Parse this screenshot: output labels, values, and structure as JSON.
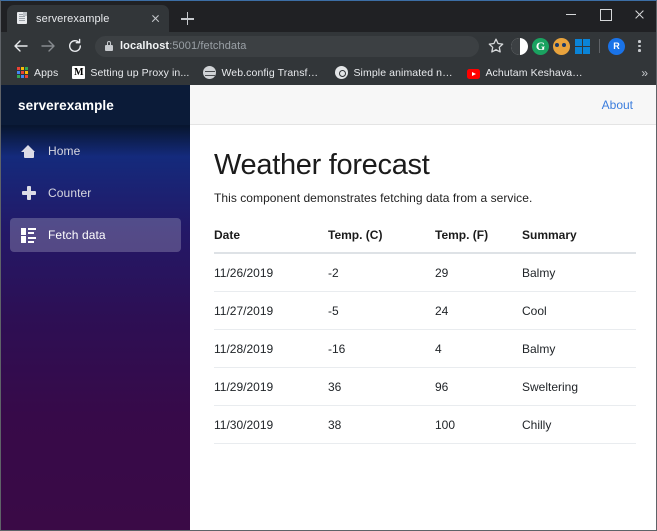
{
  "browser": {
    "tab": {
      "title": "serverexample",
      "favicon": "document-icon",
      "close_label": "",
      "new_tab_label": ""
    },
    "window_controls": {
      "minimize": "minimize-icon",
      "maximize": "maximize-icon",
      "close": "close-icon"
    },
    "toolbar": {
      "back": "back-arrow-icon",
      "forward": "forward-arrow-icon",
      "reload": "reload-icon",
      "lock": "lock-icon",
      "url_host": "localhost",
      "url_path": ":5001/fetchdata",
      "url_full": "localhost:5001/fetchdata",
      "bookmark_star": "star-icon",
      "extensions": [
        {
          "name": "half-moon-icon",
          "label": ""
        },
        {
          "name": "grammarly-icon",
          "label": "G"
        },
        {
          "name": "avatar-face-icon",
          "label": ""
        },
        {
          "name": "windows-icon",
          "label": ""
        }
      ],
      "profile_initial": "R",
      "menu": "kebab-menu-icon"
    },
    "bookmarks": {
      "items": [
        {
          "icon": "apps-grid-icon",
          "label": "Apps"
        },
        {
          "icon": "medium-icon",
          "label": "Setting up Proxy in..."
        },
        {
          "icon": "globe-icon",
          "label": "Web.config Transfo..."
        },
        {
          "icon": "gear-icon",
          "label": "Simple animated na..."
        },
        {
          "icon": "youtube-icon",
          "label": "Achutam Keshavam..."
        }
      ],
      "overflow": "»"
    }
  },
  "app": {
    "brand": "serverexample",
    "sidebar": {
      "items": [
        {
          "icon": "home-icon",
          "label": "Home",
          "active": false
        },
        {
          "icon": "plus-icon",
          "label": "Counter",
          "active": false
        },
        {
          "icon": "list-icon",
          "label": "Fetch data",
          "active": true
        }
      ]
    },
    "topbar": {
      "about_label": "About"
    },
    "page": {
      "title": "Weather forecast",
      "subtitle": "This component demonstrates fetching data from a service."
    },
    "table": {
      "columns": [
        "Date",
        "Temp. (C)",
        "Temp. (F)",
        "Summary"
      ],
      "rows": [
        {
          "date": "11/26/2019",
          "c": "-2",
          "f": "29",
          "summary": "Balmy"
        },
        {
          "date": "11/27/2019",
          "c": "-5",
          "f": "24",
          "summary": "Cool"
        },
        {
          "date": "11/28/2019",
          "c": "-16",
          "f": "4",
          "summary": "Balmy"
        },
        {
          "date": "11/29/2019",
          "c": "36",
          "f": "96",
          "summary": "Sweltering"
        },
        {
          "date": "11/30/2019",
          "c": "38",
          "f": "100",
          "summary": "Chilly"
        }
      ]
    }
  },
  "colors": {
    "chrome_frame": "#202124",
    "chrome_toolbar": "#323639",
    "sidebar_top": "#081630",
    "sidebar_mid": "#142a7c",
    "sidebar_bottom": "#3a0a46",
    "link_blue": "#3b7ddd",
    "topbar_grey": "#f7f7f7"
  }
}
